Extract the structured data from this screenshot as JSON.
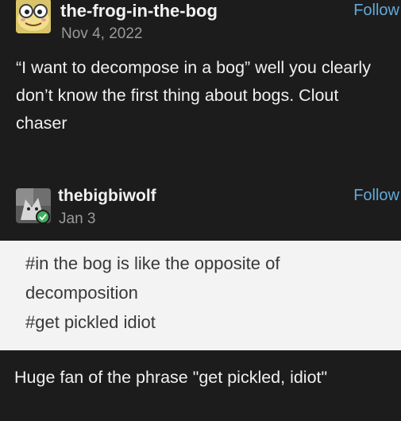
{
  "post1": {
    "username": "the-frog-in-the-bog",
    "date": "Nov 4, 2022",
    "follow_label": "Follow",
    "text": "“I want to decompose in a bog” well you clearly don’t know the first thing about bogs. Clout chaser",
    "avatar_icon": "frog-avatar-icon"
  },
  "post2": {
    "username": "thebigbiwolf",
    "date": "Jan 3",
    "follow_label": "Follow",
    "avatar_icon": "wolf-avatar-icon",
    "tags": [
      "#in the bog is like the opposite of decomposition",
      "#get pickled idiot"
    ]
  },
  "reply": {
    "text": "Huge fan of the phrase \"get pickled, idiot\""
  },
  "colors": {
    "background_dark": "#1c1c1c",
    "tags_background": "#f3f3f3",
    "follow_link": "#63a9d6",
    "date_text": "#9a9a9a"
  }
}
